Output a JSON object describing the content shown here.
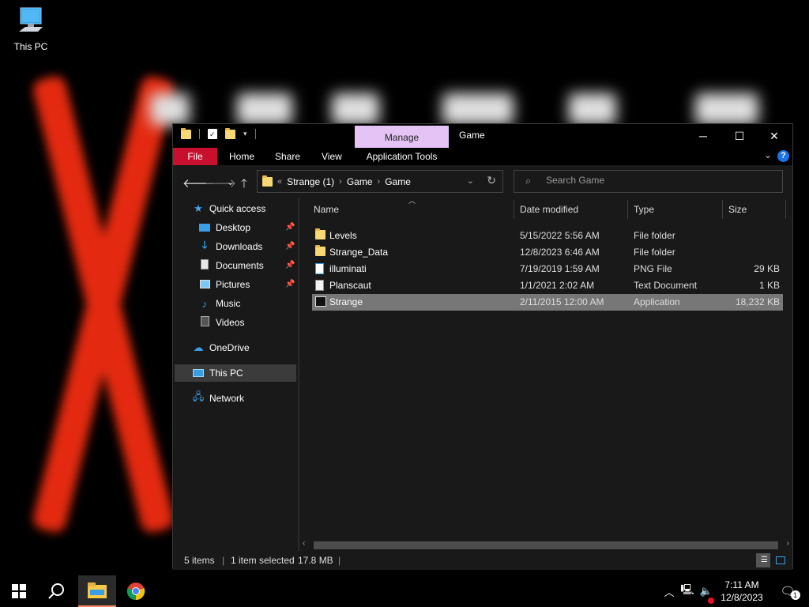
{
  "desktop": {
    "icon_label": "This PC"
  },
  "window": {
    "title": "Game",
    "manage_tab": "Manage",
    "app_tools_tab": "Application Tools",
    "ribbon_tabs": {
      "file": "File",
      "home": "Home",
      "share": "Share",
      "view": "View"
    },
    "help_label": "?"
  },
  "address": {
    "overflow": "«",
    "crumbs": [
      "Strange (1)",
      "Game",
      "Game"
    ]
  },
  "search": {
    "placeholder": "Search Game"
  },
  "navpane": {
    "quick_access": "Quick access",
    "items": [
      {
        "label": "Desktop",
        "icon": "desktop-icon"
      },
      {
        "label": "Downloads",
        "icon": "download-icon"
      },
      {
        "label": "Documents",
        "icon": "documents-icon"
      },
      {
        "label": "Pictures",
        "icon": "pictures-icon"
      },
      {
        "label": "Music",
        "icon": "music-icon"
      },
      {
        "label": "Videos",
        "icon": "videos-icon"
      }
    ],
    "onedrive": "OneDrive",
    "this_pc": "This PC",
    "network": "Network"
  },
  "columns": {
    "name": "Name",
    "date": "Date modified",
    "type": "Type",
    "size": "Size"
  },
  "files": [
    {
      "name": "Levels",
      "date": "5/15/2022 5:56 AM",
      "type": "File folder",
      "size": "",
      "icon": "folder-icon"
    },
    {
      "name": "Strange_Data",
      "date": "12/8/2023 6:46 AM",
      "type": "File folder",
      "size": "",
      "icon": "folder-icon"
    },
    {
      "name": "illuminati",
      "date": "7/19/2019 1:59 AM",
      "type": "PNG File",
      "size": "29 KB",
      "icon": "image-file-icon"
    },
    {
      "name": "Planscaut",
      "date": "1/1/2021 2:02 AM",
      "type": "Text Document",
      "size": "1 KB",
      "icon": "text-file-icon"
    },
    {
      "name": "Strange",
      "date": "2/11/2015 12:00 AM",
      "type": "Application",
      "size": "18,232 KB",
      "icon": "application-icon",
      "selected": true
    }
  ],
  "status": {
    "items": "5 items",
    "selected": "1 item selected",
    "size": "17.8 MB"
  },
  "taskbar": {
    "time": "7:11 AM",
    "date": "12/8/2023",
    "notification_count": "1"
  },
  "colors": {
    "file_tab": "#c8102e",
    "manage_tab": "#e5c4f5",
    "wallpaper_x": "#e32a10",
    "selection": "#777777"
  }
}
